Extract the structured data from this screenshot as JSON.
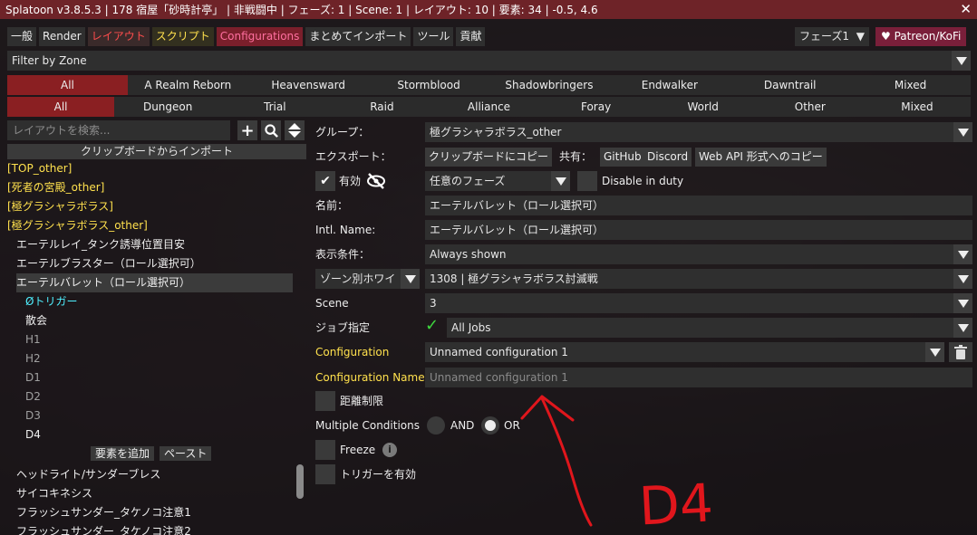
{
  "window": {
    "title": "Splatoon v3.8.5.3 | 178 宿屋「砂時計亭」 | 非戦闘中 | フェーズ: 1 | Scene: 1 | レイアウト: 10 | 要素: 34 | -0.5, 4.6",
    "close_glyph": "✕"
  },
  "tabs": [
    {
      "label": "一般",
      "style": "normal"
    },
    {
      "label": "Render",
      "style": "normal"
    },
    {
      "label": "レイアウト",
      "style": "red"
    },
    {
      "label": "スクリプト",
      "style": "yellow"
    },
    {
      "label": "Configurations",
      "style": "active"
    },
    {
      "label": "まとめてインポート",
      "style": "normal"
    },
    {
      "label": "ツール",
      "style": "normal"
    },
    {
      "label": "貢献",
      "style": "normal"
    }
  ],
  "phase_button": {
    "label": "フェーズ1",
    "arrow": "▼"
  },
  "patreon_button": {
    "label": "♥ Patreon/KoFi"
  },
  "zone_filter": {
    "value": "Filter by Zone"
  },
  "expansions": [
    "All",
    "A Realm Reborn",
    "Heavensward",
    "Stormblood",
    "Shadowbringers",
    "Endwalker",
    "Dawntrail",
    "Mixed"
  ],
  "content_types": [
    "All",
    "Dungeon",
    "Trial",
    "Raid",
    "Alliance",
    "Foray",
    "World",
    "Other",
    "Mixed"
  ],
  "sidebar": {
    "search_placeholder": "レイアウトを検索...",
    "add_glyph": "+",
    "search_glyph": "🔍",
    "sort_glyph": "⇕",
    "import_label": "クリップボードからインポート",
    "tree": [
      {
        "label": "[TOP_other]",
        "style": "yellow",
        "indent": 0
      },
      {
        "label": "[死者の宮殿_other]",
        "style": "yellow",
        "indent": 0
      },
      {
        "label": "[極グラシャラボラス]",
        "style": "yellow",
        "indent": 0
      },
      {
        "label": "[極グラシャラボラス_other]",
        "style": "yellow",
        "indent": 0
      },
      {
        "label": "エーテルレイ_タンク誘導位置目安",
        "style": "white",
        "indent": 1
      },
      {
        "label": "エーテルブラスター（ロール選択可）",
        "style": "white",
        "indent": 1
      },
      {
        "label": "エーテルバレット（ロール選択可）",
        "style": "white",
        "indent": 1,
        "selected": true
      },
      {
        "label": "Øトリガー",
        "style": "cyan",
        "indent": 2
      },
      {
        "label": "散会",
        "style": "white",
        "indent": 2
      },
      {
        "label": "H1",
        "style": "grey",
        "indent": 2
      },
      {
        "label": "H2",
        "style": "grey",
        "indent": 2
      },
      {
        "label": "D1",
        "style": "grey",
        "indent": 2
      },
      {
        "label": "D2",
        "style": "grey",
        "indent": 2
      },
      {
        "label": "D3",
        "style": "grey",
        "indent": 2
      },
      {
        "label": "D4",
        "style": "white",
        "indent": 2
      }
    ],
    "add_element_label": "要素を追加",
    "paste_label": "ペースト",
    "tree_after": [
      {
        "label": "ヘッドライト/サンダーブレス",
        "style": "white"
      },
      {
        "label": "サイコキネシス",
        "style": "white"
      },
      {
        "label": "フラッシュサンダー_タケノコ注意1",
        "style": "white"
      },
      {
        "label": "フラッシュサンダー_タケノコ注意2",
        "style": "white"
      }
    ]
  },
  "editor": {
    "group_label": "グループ：",
    "group_value": "極グラシャラボラス_other",
    "export_label": "エクスポート：",
    "copy_clipboard": "クリップボードにコピー",
    "share_label": "共有：",
    "github": "GitHub",
    "discord": "Discord",
    "webapi": "Web API 形式へのコピー",
    "enabled_label": "有効",
    "eye_icon": "👁",
    "phase_value": "任意のフェーズ",
    "disable_in_duty": "Disable in duty",
    "name_label": "名前：",
    "name_value": "エーテルバレット（ロール選択可）",
    "intl_label": "Intl. Name:",
    "intl_value": "エーテルバレット（ロール選択可）",
    "display_label": "表示条件：",
    "display_value": "Always shown",
    "zone_mode": "ゾーン別ホワイ",
    "zone_value": "1308 | 極グラシャラボラス討滅戦",
    "scene_label": "Scene",
    "scene_value": "3",
    "job_label": "ジョブ指定",
    "job_check": "✓",
    "job_value": "All Jobs",
    "config_label": "Configuration",
    "config_value": "Unnamed configuration 1",
    "config_name_label": "Configuration Name",
    "config_name_placeholder": "Unnamed configuration 1",
    "distance_label": "距離制限",
    "multi_label": "Multiple Conditions",
    "and_label": "AND",
    "or_label": "OR",
    "freeze_label": "Freeze",
    "info_glyph": "i",
    "trigger_label": "トリガーを有効"
  },
  "annotation": {
    "text": "D4",
    "color": "#e0161c"
  }
}
